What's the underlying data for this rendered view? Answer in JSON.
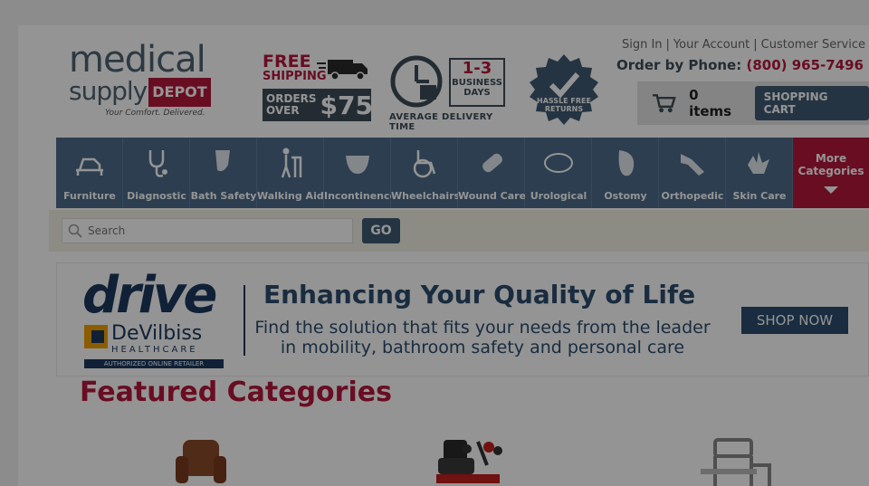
{
  "header": {
    "logo_line1": "medical",
    "logo_line2": "supply",
    "logo_depot": "DEPOT",
    "logo_tagline": "Your Comfort. Delivered.",
    "shipping_free": "FREE",
    "shipping_label": "SHIPPING",
    "orders_over": "ORDERS OVER",
    "orders_amount": "$75",
    "days_number": "1-3",
    "days_label": "BUSINESS DAYS",
    "avg_delivery": "AVERAGE DELIVERY TIME",
    "hassle_free": "HASSLE FREE RETURNS",
    "links": [
      "Sign In",
      "Your Account",
      "Customer Service"
    ],
    "phone_label": "Order by Phone:",
    "phone_number": "(800) 965-7496",
    "cart_items": "0 items",
    "cart_button": "SHOPPING CART"
  },
  "nav": {
    "items": [
      {
        "label": "Furniture",
        "icon": "bed-icon"
      },
      {
        "label": "Diagnostic",
        "icon": "stethoscope-icon"
      },
      {
        "label": "Bath Safety",
        "icon": "bath-icon"
      },
      {
        "label": "Walking Aids",
        "icon": "walker-icon"
      },
      {
        "label": "Incontinence",
        "icon": "diaper-icon"
      },
      {
        "label": "Wheelchairs",
        "icon": "wheelchair-icon"
      },
      {
        "label": "Wound Care",
        "icon": "bandage-icon"
      },
      {
        "label": "Urological",
        "icon": "catheter-icon"
      },
      {
        "label": "Ostomy",
        "icon": "ostomy-bag-icon"
      },
      {
        "label": "Orthopedic",
        "icon": "brace-icon"
      },
      {
        "label": "Skin Care",
        "icon": "glove-icon"
      }
    ],
    "more_label": "More Categories"
  },
  "search": {
    "placeholder": "Search",
    "go_label": "GO"
  },
  "banner": {
    "brand": "drive",
    "sub_brand": "DeVilbiss",
    "sub_brand_line2": "HEALTHCARE",
    "retailer": "AUTHORIZED ONLINE RETAILER",
    "headline": "Enhancing Your Quality of Life",
    "subline1": "Find the solution that fits your needs from the leader",
    "subline2": "in mobility, bathroom safety and personal care",
    "cta": "SHOP NOW"
  },
  "featured": {
    "title": "Featured Categories"
  },
  "colors": {
    "brand_red": "#b5173c",
    "brand_slate": "#3f4d59",
    "nav_blue": "#4d6b8a",
    "overlay": "rgba(0,0,0,0.42)"
  }
}
